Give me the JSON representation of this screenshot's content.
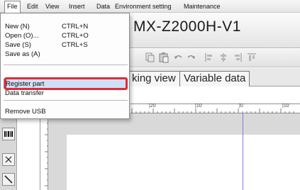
{
  "menubar": {
    "items": [
      "File",
      "Edit",
      "View",
      "Insert",
      "Data",
      "Environment setting",
      "Maintenance"
    ]
  },
  "document": {
    "title": "MX-Z2000H-V1"
  },
  "tabs": [
    "king view",
    "Variable data"
  ],
  "ruler": {
    "labels": [
      "|20",
      "|10",
      "|0",
      "|10"
    ]
  },
  "file_menu": {
    "items": [
      {
        "label": "New (N)",
        "shortcut": "CTRL+N"
      },
      {
        "label": "Open (O)...",
        "shortcut": "CTRL+O"
      },
      {
        "label": "Save (S)",
        "shortcut": "CTRL+S"
      },
      {
        "label": "Save as (A)",
        "shortcut": ""
      },
      {
        "label": "Register part",
        "shortcut": ""
      },
      {
        "label": "Data transfer",
        "shortcut": ""
      },
      {
        "label": "Remove USB",
        "shortcut": ""
      }
    ]
  },
  "colors": {
    "callout": "#e02a35",
    "guide": "#7e7edb"
  },
  "icons": [
    "copy-icon",
    "paste-icon",
    "undo-icon",
    "redo-icon",
    "align-left-icon",
    "align-center-icon",
    "align-right-icon",
    "align-top-icon",
    "barcode-icon",
    "close-icon",
    "line-icon"
  ]
}
